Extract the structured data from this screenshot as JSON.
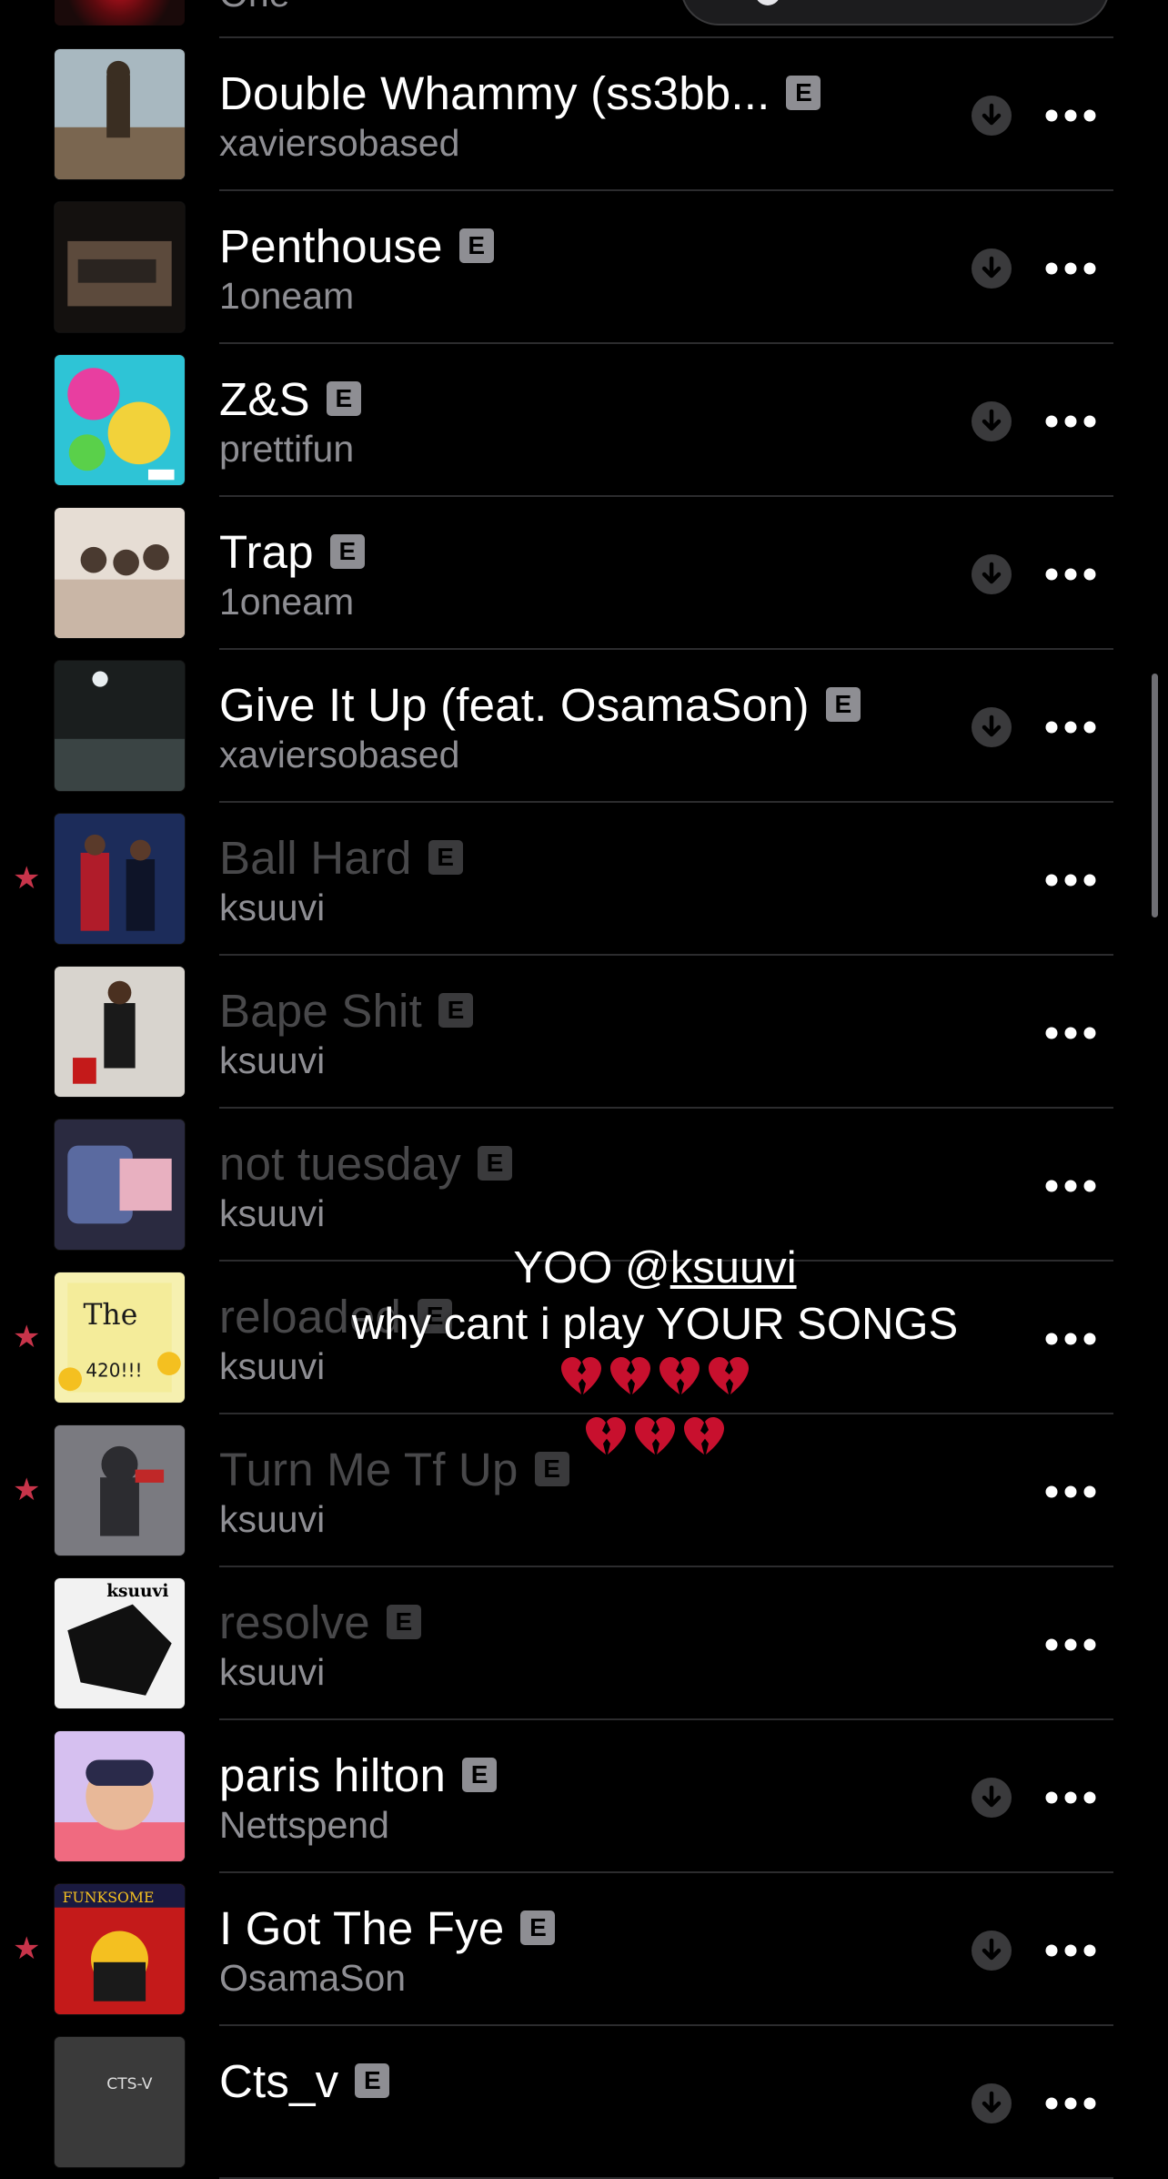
{
  "top_partial": {
    "artist": "One"
  },
  "songs": [
    {
      "title": "Double Whammy (ss3bb...",
      "artist": "xaviersobased",
      "explicit": "E",
      "star": "",
      "downloadable": true,
      "dim": false,
      "art_colors": [
        "#7a6650",
        "#a8b8c0",
        "#3a2e22"
      ]
    },
    {
      "title": "Penthouse",
      "artist": "1oneam",
      "explicit": "E",
      "star": "",
      "downloadable": true,
      "dim": false,
      "art_colors": [
        "#2a2420",
        "#5c4a3c",
        "#14110f"
      ]
    },
    {
      "title": "Z&S",
      "artist": "prettifun",
      "explicit": "E",
      "star": "",
      "downloadable": true,
      "dim": false,
      "art_colors": [
        "#2ec4d6",
        "#e83ea0",
        "#f2d23a"
      ]
    },
    {
      "title": "Trap",
      "artist": "1oneam",
      "explicit": "E",
      "star": "",
      "downloadable": true,
      "dim": false,
      "art_colors": [
        "#c9b6a6",
        "#4a3a30",
        "#e6ddd4"
      ]
    },
    {
      "title": "Give It Up (feat. OsamaSon)",
      "artist": "xaviersobased",
      "explicit": "E",
      "star": "",
      "downloadable": true,
      "dim": false,
      "art_colors": [
        "#1a1e1e",
        "#3a4444",
        "#0c0e0e"
      ]
    },
    {
      "title": "Ball Hard",
      "artist": "ksuuvi",
      "explicit": "E",
      "star": "★",
      "downloadable": false,
      "dim": true,
      "art_colors": [
        "#1c2c5a",
        "#b01c2a",
        "#0e1428"
      ]
    },
    {
      "title": "Bape Shit",
      "artist": "ksuuvi",
      "explicit": "E",
      "star": "",
      "downloadable": false,
      "dim": true,
      "art_colors": [
        "#d8d4ce",
        "#1a1a1a",
        "#a8a49e"
      ]
    },
    {
      "title": "not tuesday",
      "artist": "ksuuvi",
      "explicit": "E",
      "star": "",
      "downloadable": false,
      "dim": true,
      "art_colors": [
        "#5a6aa0",
        "#e8b0c0",
        "#2a2a40"
      ]
    },
    {
      "title": "reloaded",
      "artist": "ksuuvi",
      "explicit": "E",
      "star": "★",
      "downloadable": false,
      "dim": true,
      "art_colors": [
        "#f4ec9a",
        "#1a1a1a",
        "#e0c440"
      ]
    },
    {
      "title": "Turn Me Tf Up",
      "artist": "ksuuvi",
      "explicit": "E",
      "star": "★",
      "downloadable": false,
      "dim": true,
      "art_colors": [
        "#7a7a80",
        "#c02828",
        "#2c2c30"
      ]
    },
    {
      "title": "resolve",
      "artist": "ksuuvi",
      "explicit": "E",
      "star": "",
      "downloadable": false,
      "dim": true,
      "art_colors": [
        "#f2f2f2",
        "#101010",
        "#8a8a8a"
      ]
    },
    {
      "title": "paris hilton",
      "artist": "Nettspend",
      "explicit": "E",
      "star": "",
      "downloadable": true,
      "dim": false,
      "art_colors": [
        "#d6c0f0",
        "#f06a80",
        "#2a2a4a"
      ]
    },
    {
      "title": "I Got The Fye",
      "artist": "OsamaSon",
      "explicit": "E",
      "star": "★",
      "downloadable": true,
      "dim": false,
      "art_colors": [
        "#c41a1a",
        "#f4c020",
        "#1a1a40"
      ]
    },
    {
      "title": "Cts_v",
      "artist": "",
      "explicit": "E",
      "star": "",
      "downloadable": true,
      "dim": false,
      "art_colors": [
        "#3a3a3a",
        "#7a7a7a",
        "#1a1a1a"
      ]
    }
  ],
  "art_text": {
    "reloaded": [
      "The",
      "420!!!"
    ],
    "resolve": "ksuuvi",
    "i_got_the_fye": "FUNKSOME",
    "cts_v": "CTS-V"
  },
  "caption": {
    "prefix": "YOO @",
    "mention": "ksuuvi",
    "suffix": "  why cant i play YOUR SONGS",
    "hearts_line1": 4,
    "hearts_line2": 3
  },
  "colors": {
    "background": "#000000",
    "star": "#c8344a",
    "secondary_text": "#8e8e93",
    "dim_title": "#48484a",
    "separator": "#2c2c2e",
    "heart": "#c8102e"
  },
  "icons": {
    "download": "download-arrow-icon",
    "more": "ellipsis-icon",
    "explicit": "explicit-badge-icon",
    "favorite": "star-icon",
    "broken_heart": "broken-heart-icon"
  }
}
